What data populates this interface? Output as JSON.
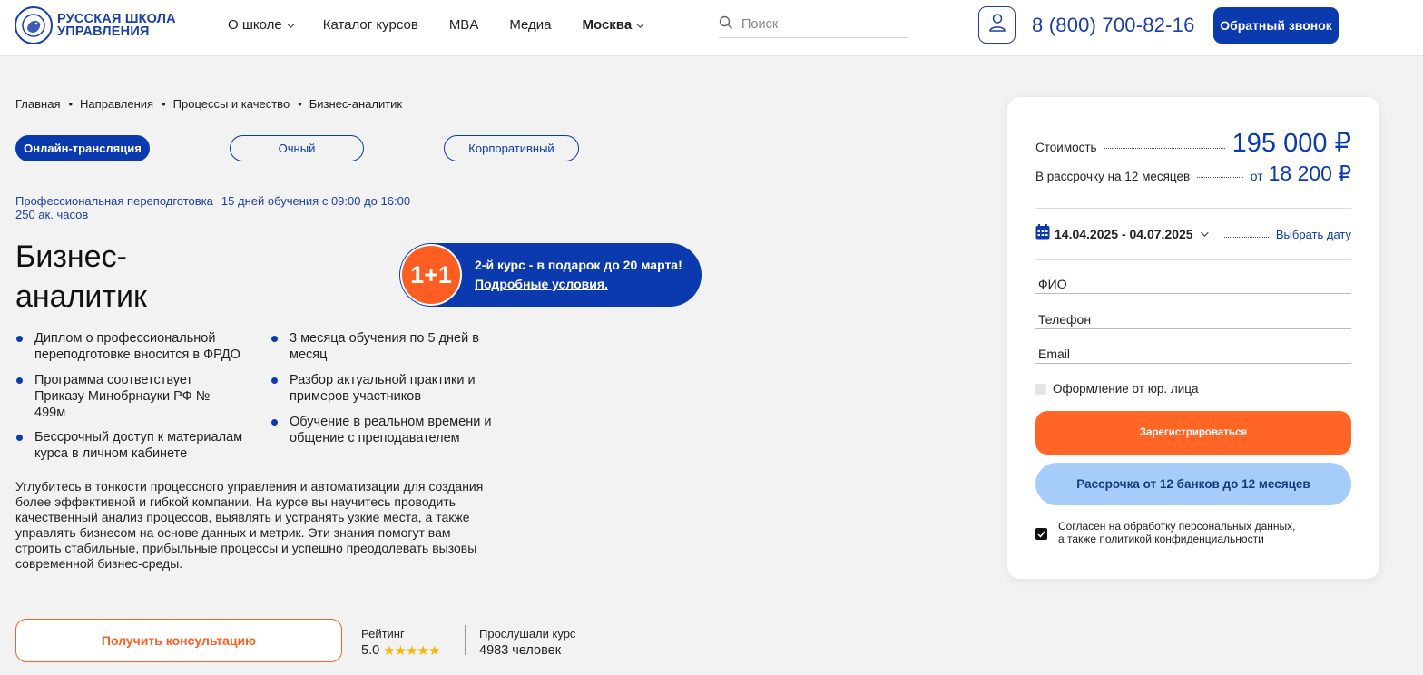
{
  "header": {
    "logo_line1": "РУССКАЯ ШКОЛА",
    "logo_line2": "УПРАВЛЕНИЯ",
    "nav": [
      "О школе",
      "Каталог курсов",
      "MBA",
      "Медиа",
      "Москва"
    ],
    "search_placeholder": "Поиск",
    "phone": "8 (800) 700-82-16",
    "callback_label": "Обратный звонок"
  },
  "breadcrumbs": [
    "Главная",
    "Направления",
    "Процессы и качество",
    "Бизнес-аналитик"
  ],
  "formats": [
    "Онлайн-трансляция",
    "Очный",
    "Корпоративный"
  ],
  "meta": {
    "type": "Профессиональная переподготовка",
    "schedule": "15 дней обучения с 09:00 до 16:00",
    "hours": "250 ак. часов"
  },
  "title_line1": "Бизнес-",
  "title_line2": "аналитик",
  "promo": {
    "badge": "1+1",
    "text": "2-й курс - в подарок до 20 марта!",
    "link": "Подробные условия."
  },
  "features_left": [
    "Диплом о профессиональной переподготовке вносится в ФРДО",
    "Программа соответствует Приказу Минобрнауки РФ № 499м",
    "Бессрочный доступ к материалам курса в личном кабинете"
  ],
  "features_right": [
    "3 месяца обучения по 5 дней в месяц",
    "Разбор актуальной практики и примеров участников",
    "Обучение в реальном времени и общение с преподавателем"
  ],
  "description": "Углубитесь в тонкости процессного управления и автоматизации для создания более эффективной и гибкой компании. На курсе вы научитесь проводить качественный анализ процессов, выявлять и устранять узкие места, а также управлять бизнесом на основе данных и метрик. Эти знания помогут вам строить стабильные, прибыльные процессы и успешно преодолевать вызовы современной бизнес-среды.",
  "consult_label": "Получить консультацию",
  "rating": {
    "label": "Рейтинг",
    "value": "5.0",
    "stars": 5
  },
  "listened": {
    "label": "Прослушали курс",
    "value": "4983 человек"
  },
  "card": {
    "price_label": "Стоимость",
    "price": "195 000 ₽",
    "installment_label": "В рассрочку на 12 месяцев",
    "installment_from": "от",
    "installment_price": "18 200 ₽",
    "dates": "14.04.2025 - 04.07.2025",
    "pick_date": "Выбрать дату",
    "fio_placeholder": "ФИО",
    "phone_placeholder": "Телефон",
    "email_placeholder": "Email",
    "legal_entity": "Оформление от юр. лица",
    "register_label": "Зарегистрироваться",
    "installment_btn": "Рассрочка от 12 банков до 12 месяцев",
    "consent_line1": "Согласен на обработку персональных данных,",
    "consent_line2": "а также политикой конфиденциальности"
  },
  "colors": {
    "brand_blue": "#0a3aae",
    "accent_orange": "#ff6525",
    "light_blue": "#a6cdfa"
  },
  "icons": [
    "lion-logo-icon",
    "chevron-down-icon",
    "search-icon",
    "user-icon",
    "calendar-icon",
    "star-icon",
    "check-icon"
  ]
}
